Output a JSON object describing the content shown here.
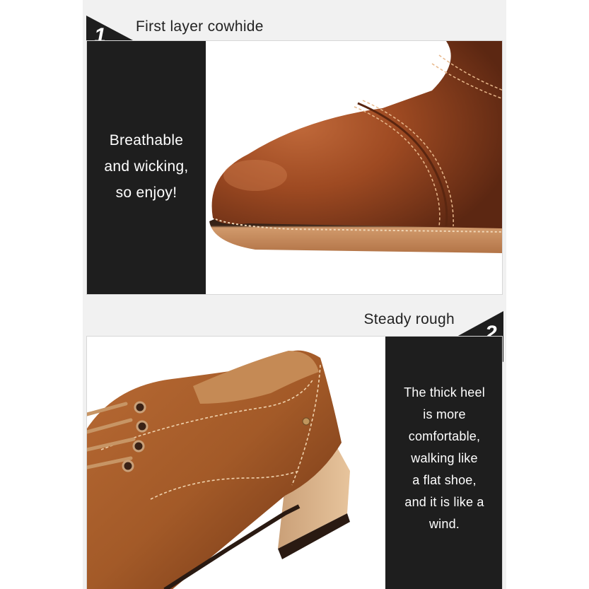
{
  "section1": {
    "number": "1",
    "title": "First layer cowhide",
    "caption_lines": [
      "Breathable",
      "and wicking,",
      "so enjoy!"
    ]
  },
  "section2": {
    "number": "2",
    "title": "Steady rough",
    "caption_lines": [
      "The thick heel",
      "is more",
      "comfortable,",
      "walking like",
      "a flat shoe,",
      "and it is like a",
      "wind."
    ]
  },
  "colors": {
    "panel_dark": "#1e1e1e",
    "leather": "#9b4a24",
    "sole": "#c98a58"
  },
  "icons": {
    "badge1": "triangle-number-badge",
    "badge2": "triangle-number-badge"
  }
}
